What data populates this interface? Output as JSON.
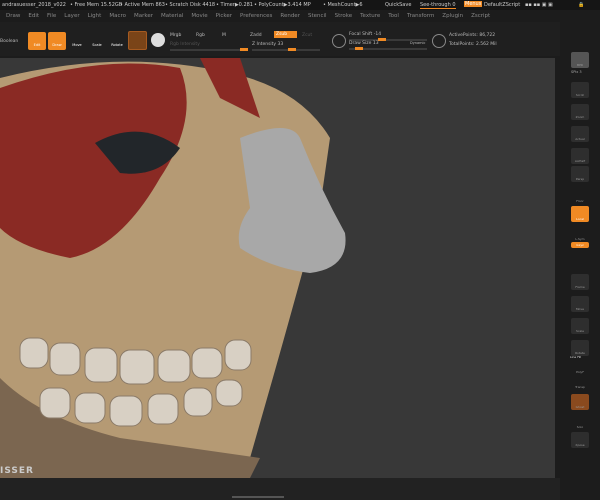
{
  "titlebar": {
    "file": "andrasuesser_2018_v022",
    "free_mem": "• Free Mem 15.52GB",
    "active_mem": "• Active Mem 863",
    "scratch": "• Scratch Disk 4418",
    "timer": "• Timer▶0.281",
    "polycount": "• PolyCount▶3.414 MP",
    "meshcount": "• MeshCount▶6",
    "quicksave": "QuickSave",
    "see_through": "See-through  0",
    "menus": "Menus",
    "script": "DefaultZScript"
  },
  "menu": [
    "Draw",
    "Edit",
    "File",
    "Layer",
    "Light",
    "Macro",
    "Marker",
    "Material",
    "Movie",
    "Picker",
    "Preferences",
    "Render",
    "Stencil",
    "Stroke",
    "Texture",
    "Tool",
    "Transform",
    "Zplugin",
    "Zscript"
  ],
  "toolbar": {
    "boolean": "Boolean",
    "edit": "Edit",
    "draw": "Draw",
    "move": "Move",
    "scale": "Scale",
    "rotate": "Rotate",
    "mrgb": "Mrgb",
    "rgb": "Rgb",
    "m": "M",
    "rgb_intensity": "Rgb Intensity",
    "zadd": "Zadd",
    "zsub": "Zsub",
    "zcut": "Zcut",
    "z_intensity": "Z Intensity 33",
    "focal_shift": "Focal Shift -14",
    "draw_size": "Draw Size 13",
    "dynamic": "Dynamic",
    "active_points": "ActivePoints: 86,722",
    "total_points": "TotalPoints: 2.562 Mil"
  },
  "shelf": {
    "bpr": "BPR",
    "spix": "SPix 3",
    "scroll": "Scroll",
    "zoom": "Zoom",
    "actual": "Actual",
    "aahalf": "AAHalf",
    "persp": "Persp",
    "floor": "Floor",
    "local": "Local",
    "lsym": "L.Sym",
    "gxyz": "Gxyz",
    "frame": "Frame",
    "move": "Move",
    "scale": "Scale",
    "rotate": "Rotate",
    "linefill": "Line Fill",
    "polyf": "PolyF",
    "transp": "Transp",
    "ghost": "Ghost",
    "solo": "Solo",
    "xpose": "Xpose"
  },
  "watermark": "ISSER",
  "colors": {
    "accent": "#f08a24",
    "canvas": "#383838",
    "bone": "#b59a74",
    "muscle": "#8a2a24",
    "nose": "#a8a8a8"
  }
}
